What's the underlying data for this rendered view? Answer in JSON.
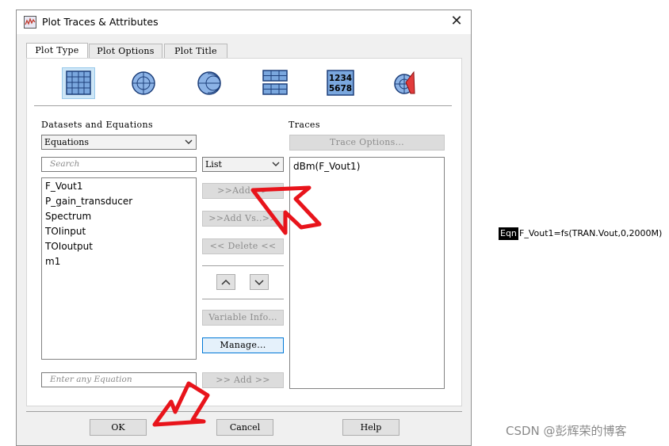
{
  "window": {
    "title": "Plot Traces & Attributes",
    "close_label": "✕"
  },
  "tabs": [
    {
      "label": "Plot Type"
    },
    {
      "label": "Plot Options"
    },
    {
      "label": "Plot Title"
    }
  ],
  "plot_type_icons": [
    {
      "icon": "rectangular-plot-icon",
      "selected": true
    },
    {
      "icon": "polar-plot-icon",
      "selected": false
    },
    {
      "icon": "smith-chart-icon",
      "selected": false
    },
    {
      "icon": "stacked-rectangular-plot-icon",
      "selected": false
    },
    {
      "icon": "list-table-icon",
      "selected": false,
      "text_top": "1234",
      "text_bottom": "5678"
    },
    {
      "icon": "antenna-plot-icon",
      "selected": false
    }
  ],
  "datasets": {
    "label": "Datasets and Equations",
    "selected": "Equations",
    "search_placeholder": "Search",
    "items": [
      "F_Vout1",
      "P_gain_transducer",
      "Spectrum",
      "TOIinput",
      "TOIoutput",
      "m1"
    ],
    "equation_placeholder": "Enter any Equation"
  },
  "view_mode": {
    "selected": "List"
  },
  "actions": {
    "add": ">>Add >>",
    "add_vs": ">>Add Vs..>>",
    "delete": "<< Delete <<",
    "variable_info": "Variable Info...",
    "manage": "Manage...",
    "add_equation": ">> Add >>"
  },
  "traces": {
    "label": "Traces",
    "options_button": "Trace Options...",
    "items": [
      "dBm(F_Vout1)"
    ]
  },
  "footer": {
    "ok": "OK",
    "cancel": "Cancel",
    "help": "Help"
  },
  "schematic_equation": {
    "tag": "Eqn",
    "text": "F_Vout1=fs(TRAN.Vout,0,2000M)"
  },
  "watermark": "CSDN @彭辉荣的博客",
  "colors": {
    "annotation_arrow": "#e8141b",
    "selection": "#cde6f7",
    "accent": "#0078d7"
  }
}
